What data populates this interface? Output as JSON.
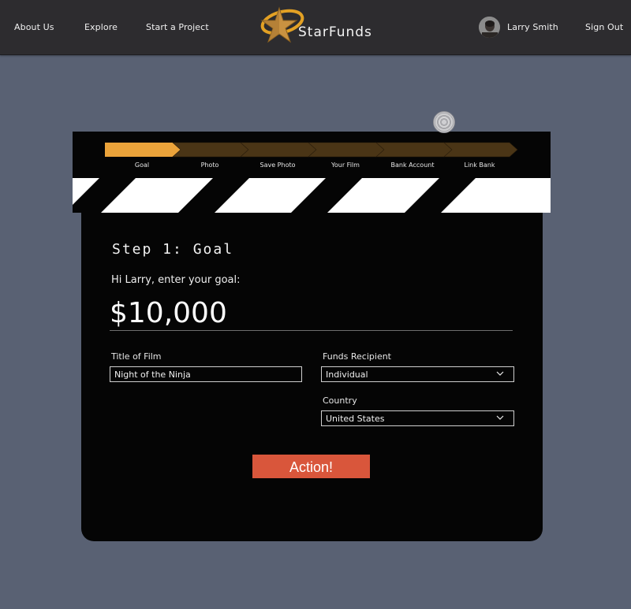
{
  "nav": {
    "about": "About Us",
    "explore": "Explore",
    "start": "Start a Project",
    "brand": "StarFunds",
    "user_name": "Larry Smith",
    "sign_out": "Sign Out"
  },
  "steps": [
    {
      "label": "Goal",
      "active": true
    },
    {
      "label": "Photo",
      "active": false
    },
    {
      "label": "Save Photo",
      "active": false
    },
    {
      "label": "Your Film",
      "active": false
    },
    {
      "label": "Bank Account",
      "active": false
    },
    {
      "label": "Link Bank",
      "active": false
    }
  ],
  "form": {
    "step_title": "Step 1: Goal",
    "greeting": "Hi Larry, enter your goal:",
    "amount": "$10,000",
    "title_label": "Title of Film",
    "title_value": "Night of the Ninja",
    "recipient_label": "Funds Recipient",
    "recipient_value": "Individual",
    "country_label": "Country",
    "country_value": "United States",
    "action_label": "Action!"
  },
  "colors": {
    "active_step": "#eba33a",
    "inactive_step": "#4a3516",
    "action_button": "#d9563b",
    "background": "#596173"
  }
}
